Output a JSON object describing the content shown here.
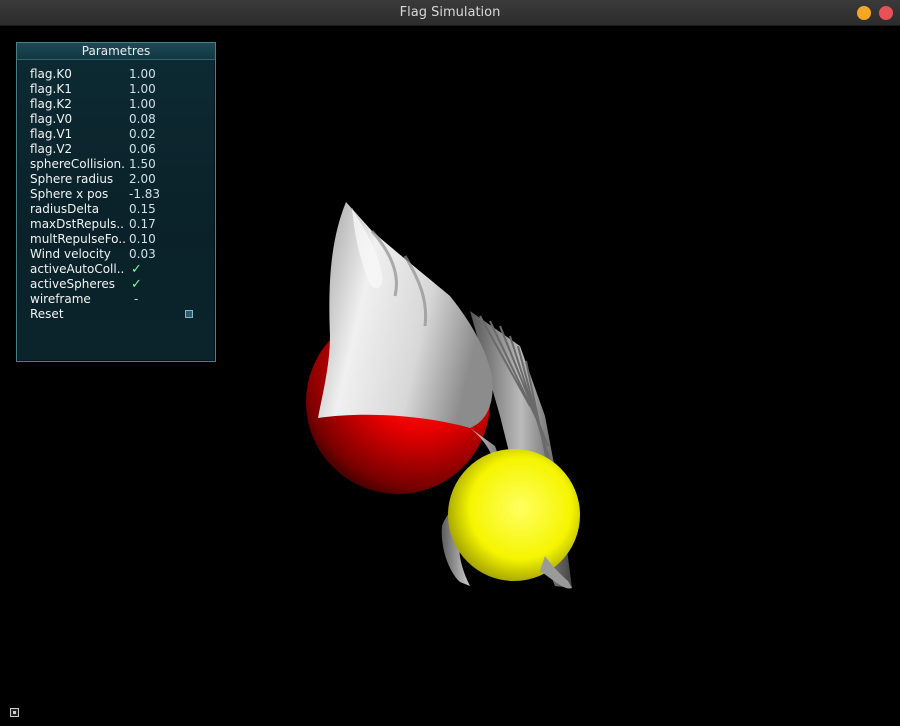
{
  "window": {
    "title": "Flag Simulation",
    "minimize_color": "#f5a623",
    "close_color": "#e9505a"
  },
  "panel": {
    "title": "Parametres",
    "params": [
      {
        "label": "flag.K0",
        "value": "1.00"
      },
      {
        "label": "flag.K1",
        "value": "1.00"
      },
      {
        "label": "flag.K2",
        "value": "1.00"
      },
      {
        "label": "flag.V0",
        "value": "0.08"
      },
      {
        "label": "flag.V1",
        "value": "0.02"
      },
      {
        "label": "flag.V2",
        "value": "0.06"
      },
      {
        "label": "sphereCollision..",
        "value": "1.50"
      },
      {
        "label": "Sphere radius",
        "value": "2.00"
      },
      {
        "label": "Sphere x pos",
        "value": "-1.83"
      },
      {
        "label": "radiusDelta",
        "value": "0.15"
      },
      {
        "label": "maxDstRepuls..",
        "value": "0.17"
      },
      {
        "label": "multRepulseFo..",
        "value": "0.10"
      },
      {
        "label": "Wind velocity",
        "value": "0.03"
      }
    ],
    "toggles": [
      {
        "label": "activeAutoColl..",
        "state": "✓"
      },
      {
        "label": "activeSpheres",
        "state": "✓"
      },
      {
        "label": "wireframe",
        "state": "-"
      }
    ],
    "reset_label": "Reset"
  },
  "scene": {
    "red_sphere_color": "#ff0000",
    "yellow_sphere_color": "#ffff00",
    "cloth_color": "#e6e6e6",
    "background_color": "#000000"
  }
}
